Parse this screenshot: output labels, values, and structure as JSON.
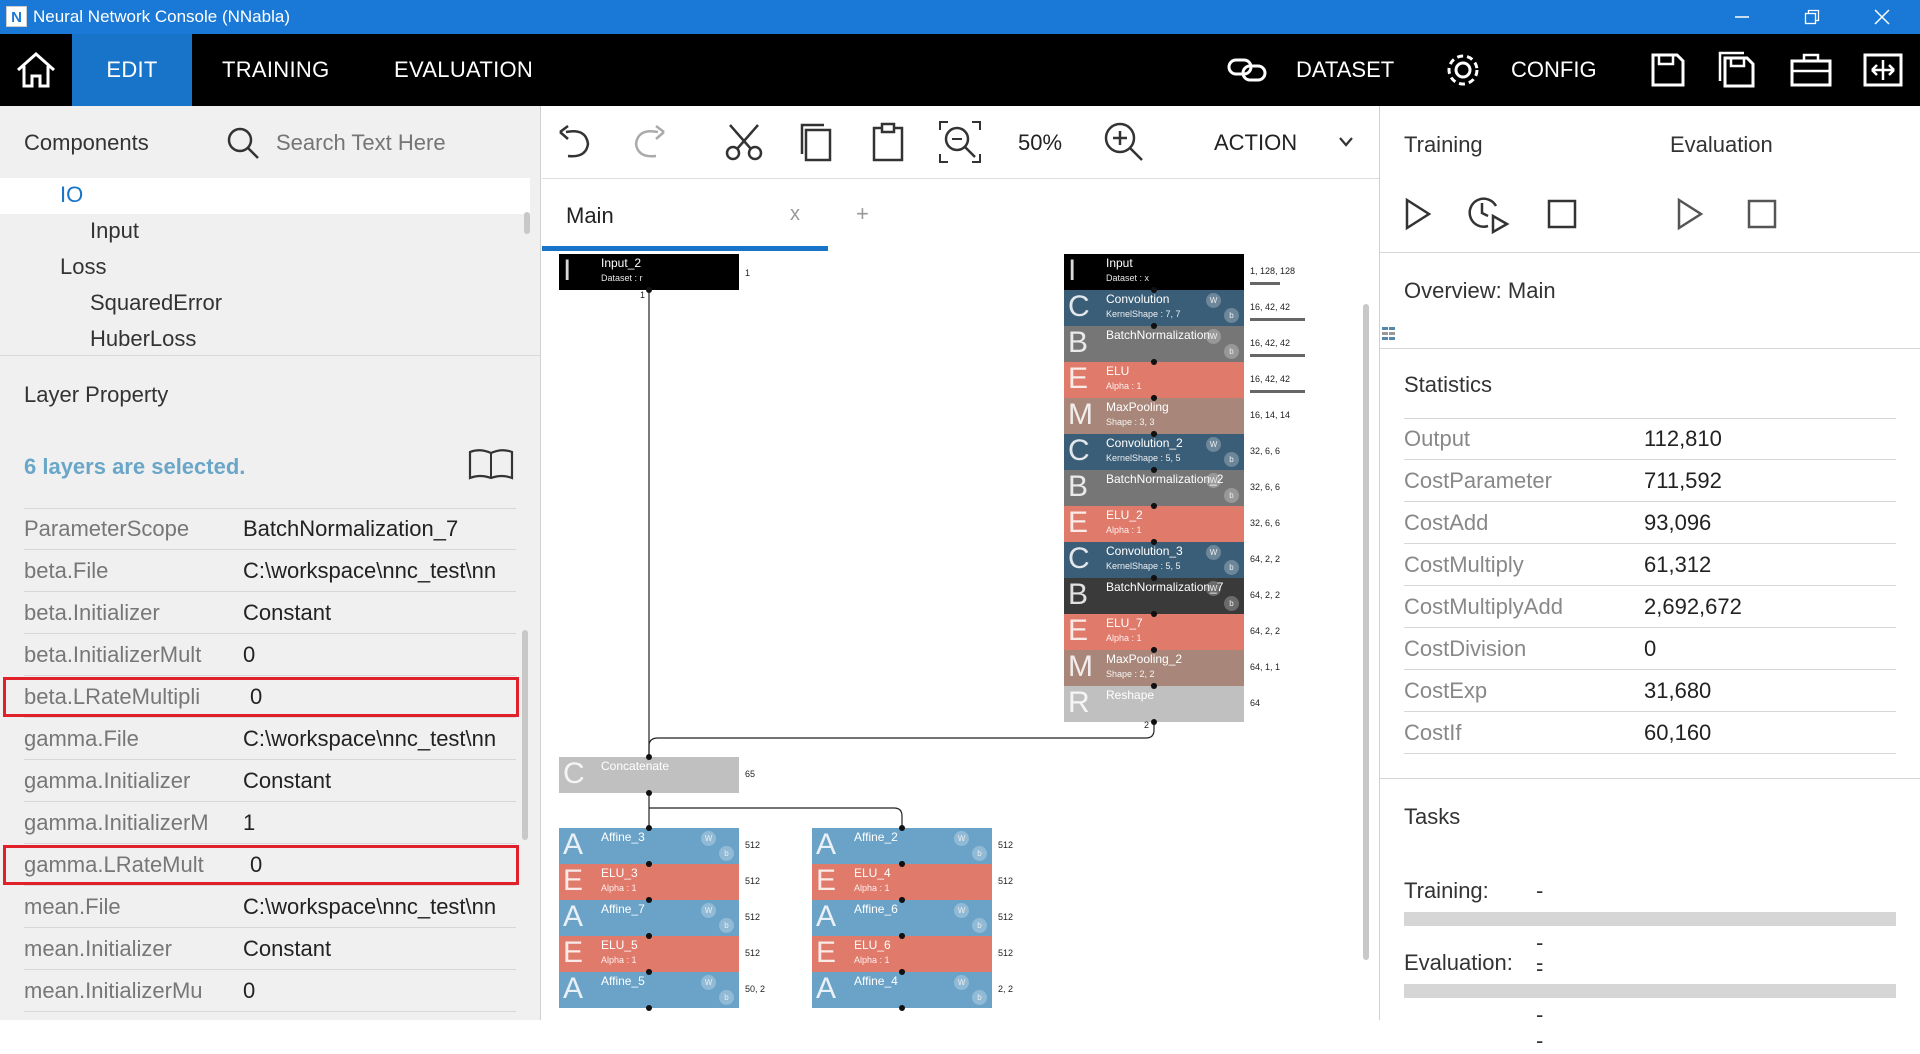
{
  "window": {
    "app_icon": "N",
    "title": "Neural Network Console (NNabla)"
  },
  "menu": {
    "tabs": [
      "EDIT",
      "TRAINING",
      "EVALUATION"
    ],
    "dataset": "DATASET",
    "config": "CONFIG"
  },
  "components": {
    "header": "Components",
    "search_placeholder": "Search Text Here",
    "tree": [
      {
        "label": "IO",
        "level": 1,
        "selected": true
      },
      {
        "label": "Input",
        "level": 2
      },
      {
        "label": "Loss",
        "level": 1
      },
      {
        "label": "SquaredError",
        "level": 2
      },
      {
        "label": "HuberLoss",
        "level": 2
      }
    ]
  },
  "layer_property": {
    "header": "Layer Property",
    "selection_text": "6 layers are selected.",
    "rows": [
      {
        "key": "ParameterScope",
        "value": "BatchNormalization_7"
      },
      {
        "key": "beta.File",
        "value": "C:\\workspace\\nnc_test\\nn"
      },
      {
        "key": "beta.Initializer",
        "value": "Constant"
      },
      {
        "key": "beta.InitializerMult",
        "value": "0"
      },
      {
        "key": "beta.LRateMultipli",
        "value": "0",
        "highlighted": true
      },
      {
        "key": "gamma.File",
        "value": "C:\\workspace\\nnc_test\\nn"
      },
      {
        "key": "gamma.Initializer",
        "value": "Constant"
      },
      {
        "key": "gamma.InitializerM",
        "value": "1"
      },
      {
        "key": "gamma.LRateMult",
        "value": "0",
        "highlighted": true
      },
      {
        "key": "mean.File",
        "value": "C:\\workspace\\nnc_test\\nn"
      },
      {
        "key": "mean.Initializer",
        "value": "Constant"
      },
      {
        "key": "mean.InitializerMu",
        "value": "0"
      }
    ]
  },
  "editor": {
    "zoom": "50%",
    "action": "ACTION",
    "tab_name": "Main",
    "tab_close": "x",
    "tab_add": "+"
  },
  "network": {
    "colors": {
      "Input": "#000000",
      "Convolution": "#3b5e78",
      "BatchNormalization": "#767676",
      "ELU": "#e07a6a",
      "MaxPooling": "#a8877a",
      "Reshape": "#c0c0c0",
      "Concatenate": "#c0c0c0",
      "Affine": "#6ba3c8"
    },
    "layers": [
      {
        "letter": "I",
        "name": "Input_2",
        "param": "Dataset : r",
        "type": "Input",
        "shape": "1"
      },
      {
        "letter": "I",
        "name": "Input",
        "param": "Dataset : x",
        "type": "Input",
        "shape": "1, 128, 128"
      },
      {
        "letter": "C",
        "name": "Convolution",
        "param": "KernelShape : 7, 7",
        "type": "Convolution",
        "shape": "16, 42, 42",
        "wb": true
      },
      {
        "letter": "B",
        "name": "BatchNormalization",
        "param": "",
        "type": "BatchNormalization",
        "shape": "16, 42, 42",
        "wb": true
      },
      {
        "letter": "E",
        "name": "ELU",
        "param": "Alpha : 1",
        "type": "ELU",
        "shape": "16, 42, 42"
      },
      {
        "letter": "M",
        "name": "MaxPooling",
        "param": "Shape : 3, 3",
        "type": "MaxPooling",
        "shape": "16, 14, 14"
      },
      {
        "letter": "C",
        "name": "Convolution_2",
        "param": "KernelShape : 5, 5",
        "type": "Convolution",
        "shape": "32, 6, 6",
        "wb": true
      },
      {
        "letter": "B",
        "name": "BatchNormalization_2",
        "param": "",
        "type": "BatchNormalization",
        "shape": "32, 6, 6",
        "wb": true
      },
      {
        "letter": "E",
        "name": "ELU_2",
        "param": "Alpha : 1",
        "type": "ELU",
        "shape": "32, 6, 6"
      },
      {
        "letter": "C",
        "name": "Convolution_3",
        "param": "KernelShape : 5, 5",
        "type": "Convolution",
        "shape": "64, 2, 2",
        "wb": true
      },
      {
        "letter": "B",
        "name": "BatchNormalization_7",
        "param": "",
        "type": "BatchNormalization",
        "shape": "64, 2, 2",
        "wb": true,
        "dark": true
      },
      {
        "letter": "E",
        "name": "ELU_7",
        "param": "Alpha : 1",
        "type": "ELU",
        "shape": "64, 2, 2"
      },
      {
        "letter": "M",
        "name": "MaxPooling_2",
        "param": "Shape : 2, 2",
        "type": "MaxPooling",
        "shape": "64, 1, 1"
      },
      {
        "letter": "R",
        "name": "Reshape",
        "param": "",
        "type": "Reshape",
        "shape": "64"
      },
      {
        "letter": "C",
        "name": "Concatenate",
        "param": "",
        "type": "Concatenate",
        "shape": "65"
      },
      {
        "letter": "A",
        "name": "Affine_3",
        "param": "",
        "type": "Affine",
        "shape": "512",
        "wb": true
      },
      {
        "letter": "E",
        "name": "ELU_3",
        "param": "Alpha : 1",
        "type": "ELU",
        "shape": "512"
      },
      {
        "letter": "A",
        "name": "Affine_7",
        "param": "",
        "type": "Affine",
        "shape": "512",
        "wb": true
      },
      {
        "letter": "E",
        "name": "ELU_5",
        "param": "Alpha : 1",
        "type": "ELU",
        "shape": "512"
      },
      {
        "letter": "A",
        "name": "Affine_5",
        "param": "",
        "type": "Affine",
        "shape": "50, 2",
        "wb": true
      },
      {
        "letter": "A",
        "name": "Affine_2",
        "param": "",
        "type": "Affine",
        "shape": "512",
        "wb": true
      },
      {
        "letter": "E",
        "name": "ELU_4",
        "param": "Alpha : 1",
        "type": "ELU",
        "shape": "512"
      },
      {
        "letter": "A",
        "name": "Affine_6",
        "param": "",
        "type": "Affine",
        "shape": "512",
        "wb": true
      },
      {
        "letter": "E",
        "name": "ELU_6",
        "param": "Alpha : 1",
        "type": "ELU",
        "shape": "512"
      },
      {
        "letter": "A",
        "name": "Affine_4",
        "param": "",
        "type": "Affine",
        "shape": "2, 2",
        "wb": true
      }
    ],
    "reshape_out_label": "2",
    "input2_out_label": "1"
  },
  "right": {
    "training": "Training",
    "evaluation": "Evaluation",
    "overview": "Overview: Main",
    "statistics": "Statistics",
    "stats": [
      {
        "key": "Output",
        "value": "112,810"
      },
      {
        "key": "CostParameter",
        "value": "711,592"
      },
      {
        "key": "CostAdd",
        "value": "93,096"
      },
      {
        "key": "CostMultiply",
        "value": "61,312"
      },
      {
        "key": "CostMultiplyAdd",
        "value": "2,692,672"
      },
      {
        "key": "CostDivision",
        "value": "0"
      },
      {
        "key": "CostExp",
        "value": "31,680"
      },
      {
        "key": "CostIf",
        "value": "60,160"
      }
    ],
    "tasks": "Tasks",
    "training_task_label": "Training:",
    "training_task_value": "----",
    "training_progress": 0,
    "evaluation_task_label": "Evaluation:",
    "evaluation_task_value": "----",
    "evaluation_progress": 0
  }
}
